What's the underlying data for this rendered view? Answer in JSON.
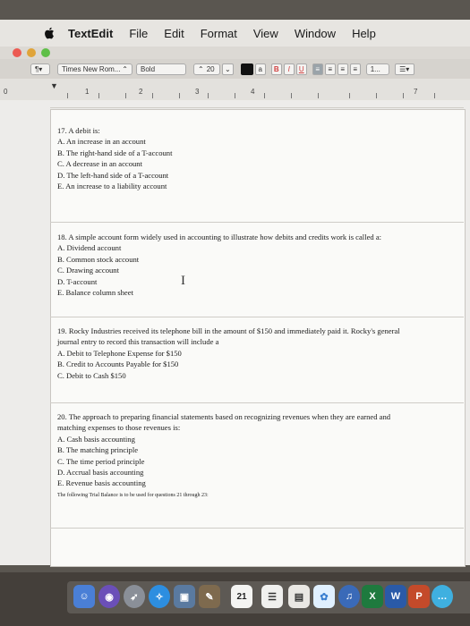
{
  "menubar": {
    "app": "TextEdit",
    "items": [
      "File",
      "Edit",
      "Format",
      "View",
      "Window",
      "Help"
    ]
  },
  "toolbar": {
    "font_name": "Times New Rom...",
    "font_style": "Bold",
    "font_size": "20",
    "format_buttons": [
      "a",
      "B",
      "I",
      "U"
    ],
    "spacing": "1..."
  },
  "ruler": {
    "numbers": [
      "0",
      "1",
      "2",
      "3",
      "4",
      "7"
    ]
  },
  "questions": [
    {
      "lines": [
        "17. A debit is:",
        "A. An increase in an account",
        "B. The right-hand side of a T-account",
        "C. A decrease in an account",
        "D. The left-hand side of a T-account",
        "E. An increase to a liability account"
      ]
    },
    {
      "lines": [
        "18. A simple account form widely used in accounting to illustrate how debits and credits work is called a:",
        "A. Dividend account",
        "B. Common stock account",
        "C. Drawing account",
        "D. T-account",
        "E. Balance column sheet"
      ]
    },
    {
      "lines": [
        "19. Rocky Industries received its telephone bill in the amount of $150 and immediately paid it. Rocky's general",
        "journal entry to record this transaction will include a",
        "A. Debit to Telephone Expense for $150",
        "B. Credit to Accounts Payable for $150",
        "C. Debit to Cash $150"
      ]
    },
    {
      "lines": [
        "20. The approach to preparing financial statements based on recognizing revenues when they are earned and",
        "matching expenses to those revenues is:",
        "A. Cash basis accounting",
        "B. The matching principle",
        "C. The time period principle",
        "D. Accrual basis accounting",
        "E. Revenue basis accounting"
      ]
    }
  ],
  "footnote": "The following Trial Balance is to be used for questions 21 through 23:",
  "dock": {
    "calendar_day": "21"
  },
  "colors": {
    "close": "#ec5a52",
    "minimize": "#e0a43a",
    "zoom": "#5fbf48"
  }
}
